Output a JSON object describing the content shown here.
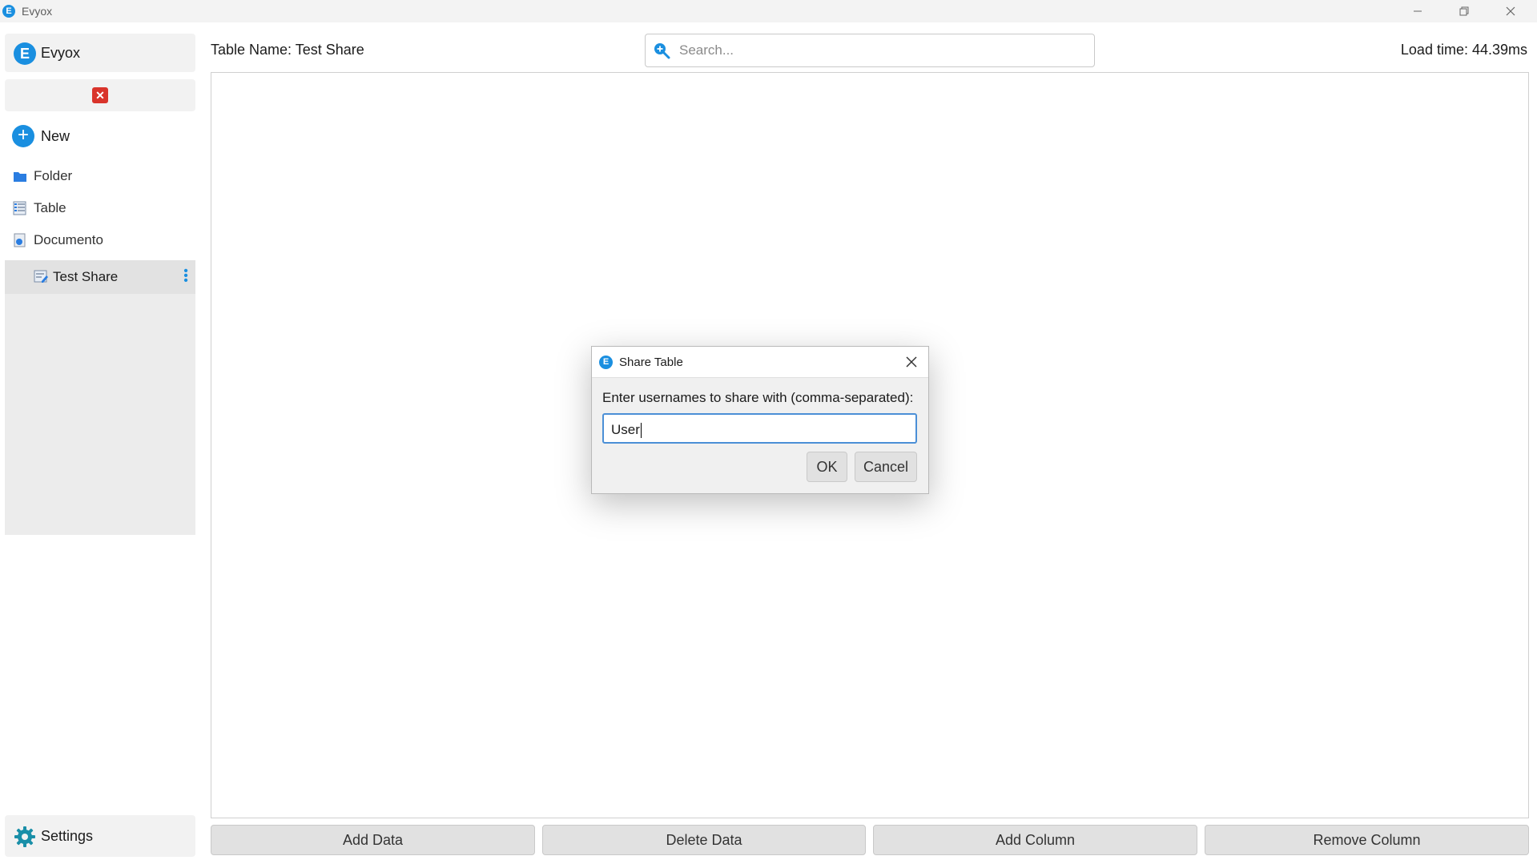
{
  "window": {
    "title": "Evyox"
  },
  "sidebar": {
    "app_name": "Evyox",
    "new_label": "New",
    "items": [
      {
        "label": "Folder",
        "icon": "folder-icon"
      },
      {
        "label": "Table",
        "icon": "table-icon"
      },
      {
        "label": "Documento",
        "icon": "document-icon"
      }
    ],
    "tree": [
      {
        "label": "Test Share",
        "icon": "table-edit-icon"
      }
    ],
    "settings_label": "Settings"
  },
  "header": {
    "table_name": "Table Name: Test Share",
    "search_placeholder": "Search...",
    "load_time": "Load time: 44.39ms"
  },
  "footer": {
    "add_data": "Add Data",
    "delete_data": "Delete Data",
    "add_column": "Add Column",
    "remove_column": "Remove Column"
  },
  "dialog": {
    "title": "Share Table",
    "prompt": "Enter usernames to share with (comma-separated):",
    "input_value": "User",
    "ok_label": "OK",
    "cancel_label": "Cancel"
  },
  "colors": {
    "accent": "#1a8fe0",
    "danger": "#d9342b"
  }
}
